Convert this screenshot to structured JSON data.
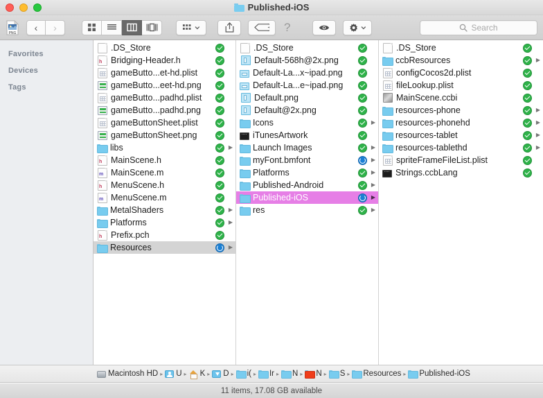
{
  "window": {
    "title": "Published-iOS",
    "traffic_lights": [
      "close",
      "minimize",
      "maximize"
    ]
  },
  "toolbar": {
    "proxy_icon": "png-document-icon",
    "back_label": "‹",
    "forward_label": "›",
    "view_buttons": [
      {
        "name": "icon-view",
        "active": false
      },
      {
        "name": "list-view",
        "active": false
      },
      {
        "name": "column-view",
        "active": true
      },
      {
        "name": "gallery-view",
        "active": false
      }
    ],
    "arrange_label": "arrange-icon",
    "share_label": "share-icon",
    "tag_label": "tag-icon",
    "help_label": "?",
    "quicklook_label": "eye-icon",
    "action_label": "gear-icon",
    "search": {
      "placeholder": "Search",
      "value": ""
    }
  },
  "sidebar": {
    "sections": [
      {
        "label": "Favorites"
      },
      {
        "label": "Devices"
      },
      {
        "label": "Tags"
      }
    ]
  },
  "columns": [
    {
      "items": [
        {
          "name": ".DS_Store",
          "icon": "blank-document-icon",
          "badge": "ok",
          "disclosure": false
        },
        {
          "name": "Bridging-Header.h",
          "icon": "h-header-file-icon",
          "badge": "ok",
          "disclosure": false
        },
        {
          "name": "gameButto...et-hd.plist",
          "icon": "plist-file-icon",
          "badge": "ok",
          "disclosure": false
        },
        {
          "name": "gameButto...eet-hd.png",
          "icon": "png-sheet-icon",
          "badge": "ok",
          "disclosure": false
        },
        {
          "name": "gameButto...padhd.plist",
          "icon": "plist-file-icon",
          "badge": "ok",
          "disclosure": false
        },
        {
          "name": "gameButto...padhd.png",
          "icon": "png-sheet-icon",
          "badge": "ok",
          "disclosure": false
        },
        {
          "name": "gameButtonSheet.plist",
          "icon": "plist-file-icon",
          "badge": "ok",
          "disclosure": false
        },
        {
          "name": "gameButtonSheet.png",
          "icon": "png-sheet-icon",
          "badge": "ok",
          "disclosure": false
        },
        {
          "name": "libs",
          "icon": "folder-icon",
          "badge": "ok",
          "disclosure": true
        },
        {
          "name": "MainScene.h",
          "icon": "h-header-file-icon",
          "badge": "ok",
          "disclosure": false
        },
        {
          "name": "MainScene.m",
          "icon": "m-source-file-icon",
          "badge": "ok",
          "disclosure": false
        },
        {
          "name": "MenuScene.h",
          "icon": "h-header-file-icon",
          "badge": "ok",
          "disclosure": false
        },
        {
          "name": "MenuScene.m",
          "icon": "m-source-file-icon",
          "badge": "ok",
          "disclosure": false
        },
        {
          "name": "MetalShaders",
          "icon": "folder-icon",
          "badge": "ok",
          "disclosure": true
        },
        {
          "name": "Platforms",
          "icon": "folder-icon",
          "badge": "ok",
          "disclosure": true
        },
        {
          "name": "Prefix.pch",
          "icon": "h-header-file-icon",
          "badge": "ok",
          "disclosure": false
        },
        {
          "name": "Resources",
          "icon": "folder-icon",
          "badge": "sync",
          "disclosure": true,
          "selected": "inactive"
        }
      ]
    },
    {
      "items": [
        {
          "name": ".DS_Store",
          "icon": "blank-document-icon",
          "badge": "ok",
          "disclosure": false
        },
        {
          "name": "Default-568h@2x.png",
          "icon": "png-portrait-icon",
          "badge": "ok",
          "disclosure": false
        },
        {
          "name": "Default-La...x~ipad.png",
          "icon": "png-landscape-icon",
          "badge": "ok",
          "disclosure": false
        },
        {
          "name": "Default-La...e~ipad.png",
          "icon": "png-landscape-icon",
          "badge": "ok",
          "disclosure": false
        },
        {
          "name": "Default.png",
          "icon": "png-portrait-icon",
          "badge": "ok",
          "disclosure": false
        },
        {
          "name": "Default@2x.png",
          "icon": "png-portrait-icon",
          "badge": "ok",
          "disclosure": false
        },
        {
          "name": "Icons",
          "icon": "folder-icon",
          "badge": "ok",
          "disclosure": true
        },
        {
          "name": "iTunesArtwork",
          "icon": "black-preview-icon",
          "badge": "ok",
          "disclosure": false
        },
        {
          "name": "Launch Images",
          "icon": "folder-icon",
          "badge": "ok",
          "disclosure": true
        },
        {
          "name": "myFont.bmfont",
          "icon": "folder-icon",
          "badge": "sync",
          "disclosure": true
        },
        {
          "name": "Platforms",
          "icon": "folder-icon",
          "badge": "ok",
          "disclosure": true
        },
        {
          "name": "Published-Android",
          "icon": "folder-icon",
          "badge": "ok",
          "disclosure": true
        },
        {
          "name": "Published-iOS",
          "icon": "folder-icon",
          "badge": "sync",
          "disclosure": true,
          "selected": "active"
        },
        {
          "name": "res",
          "icon": "folder-icon",
          "badge": "ok",
          "disclosure": true
        }
      ]
    },
    {
      "items": [
        {
          "name": ".DS_Store",
          "icon": "blank-document-icon",
          "badge": "ok",
          "disclosure": false
        },
        {
          "name": "ccbResources",
          "icon": "folder-icon",
          "badge": "ok",
          "disclosure": true
        },
        {
          "name": "configCocos2d.plist",
          "icon": "plist-file-icon",
          "badge": "ok",
          "disclosure": false
        },
        {
          "name": "fileLookup.plist",
          "icon": "plist-file-icon",
          "badge": "ok",
          "disclosure": false
        },
        {
          "name": "MainScene.ccbi",
          "icon": "ccbi-file-icon",
          "badge": "ok",
          "disclosure": false
        },
        {
          "name": "resources-phone",
          "icon": "folder-icon",
          "badge": "ok",
          "disclosure": true
        },
        {
          "name": "resources-phonehd",
          "icon": "folder-icon",
          "badge": "ok",
          "disclosure": true
        },
        {
          "name": "resources-tablet",
          "icon": "folder-icon",
          "badge": "ok",
          "disclosure": true
        },
        {
          "name": "resources-tablethd",
          "icon": "folder-icon",
          "badge": "ok",
          "disclosure": true
        },
        {
          "name": "spriteFrameFileList.plist",
          "icon": "plist-file-icon",
          "badge": "ok",
          "disclosure": false
        },
        {
          "name": "Strings.ccbLang",
          "icon": "black-preview-icon",
          "badge": "ok",
          "disclosure": false
        }
      ]
    }
  ],
  "pathbar": {
    "segments": [
      {
        "label": "Macintosh HD",
        "icon": "harddisk-icon"
      },
      {
        "label": "U",
        "icon": "users-icon"
      },
      {
        "label": "K",
        "icon": "home-icon"
      },
      {
        "label": "D",
        "icon": "downloads-icon"
      },
      {
        "label": "i(",
        "icon": "folder-icon"
      },
      {
        "label": "Ir",
        "icon": "folder-icon"
      },
      {
        "label": "N",
        "icon": "folder-icon"
      },
      {
        "label": "N",
        "icon": "folder-red-icon"
      },
      {
        "label": "S",
        "icon": "folder-icon"
      },
      {
        "label": "Resources",
        "icon": "folder-icon"
      },
      {
        "label": "Published-iOS",
        "icon": "folder-icon"
      }
    ],
    "separator": "▸"
  },
  "statusbar": {
    "text": "11 items, 17.08 GB available"
  },
  "colors": {
    "selection_active": "#e67fe6",
    "selection_inactive": "#d4d4d4",
    "badge_ok": "#2fb34a",
    "badge_sync": "#1b7fd4",
    "folder_blue": "#78ccef"
  }
}
